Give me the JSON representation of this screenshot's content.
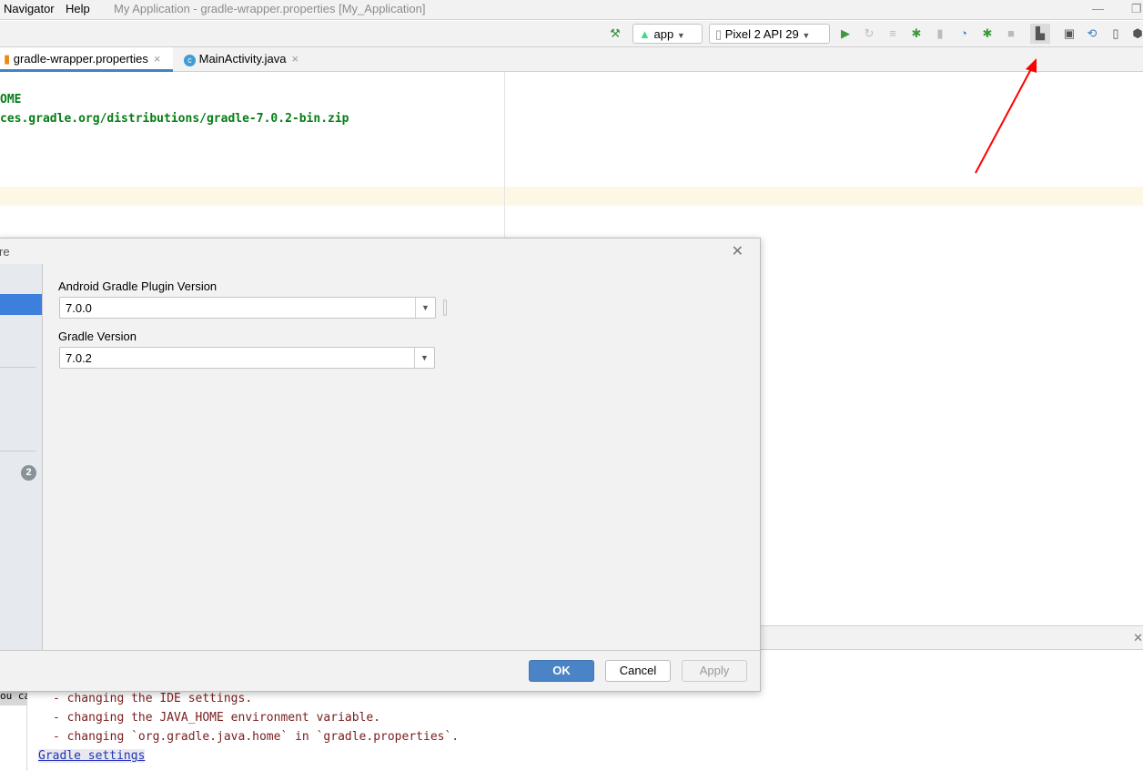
{
  "menubar": {
    "items": [
      "Navigator",
      "Help"
    ],
    "window_title": "My Application - gradle-wrapper.properties [My_Application]"
  },
  "toolbar": {
    "config": "app",
    "device": "Pixel 2 API 29",
    "icons": [
      "hammer-icon",
      "run-icon",
      "apply-changes-icon",
      "apply-code-changes-icon",
      "debug-icon",
      "attach-icon",
      "profile-icon",
      "attach-debugger-icon",
      "stop-icon",
      "project-structure-icon",
      "layout-inspector-icon",
      "sync-icon",
      "avd-manager-icon",
      "sdk-manager-icon"
    ]
  },
  "tabs": [
    {
      "label": "gradle-wrapper.properties",
      "icon": "properties-file-icon"
    },
    {
      "label": "MainActivity.java",
      "icon": "java-class-icon"
    }
  ],
  "editor": {
    "lines": [
      "OME",
      "ces.gradle.org/distributions/gradle-7.0.2-bin.zip"
    ]
  },
  "dialog": {
    "title_fragment": "re",
    "badge": "2",
    "agp_label": "Android Gradle Plugin Version",
    "agp_value": "7.0.0",
    "gradle_label": "Gradle Version",
    "gradle_value": "7.0.2",
    "ok": "OK",
    "cancel": "Cancel",
    "apply": "Apply",
    "accent": "#4a84c6"
  },
  "output": {
    "gutter_text": "ou ca",
    "lines": [
      "- changing the IDE settings.",
      "- changing the JAVA_HOME environment variable.",
      "- changing `org.gradle.java.home` in `gradle.properties`."
    ],
    "link": "Gradle settings"
  },
  "annotation": {
    "color": "#ff0000"
  }
}
